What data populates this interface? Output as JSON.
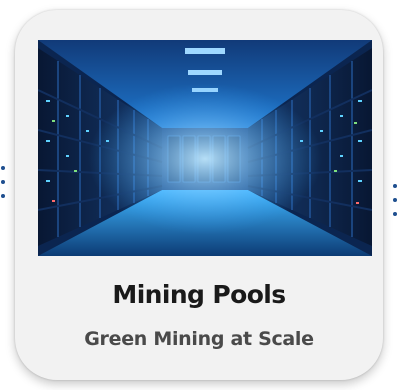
{
  "card": {
    "title": "Mining Pools",
    "subtitle": "Green Mining at Scale",
    "image_icon": "server-room-image"
  },
  "colors": {
    "card_background": "#f2f2f2",
    "title": "#1a1a1a",
    "subtitle": "#4a4a4a",
    "connector": "#1f4f8f",
    "image_glow": "#35a6ff"
  }
}
